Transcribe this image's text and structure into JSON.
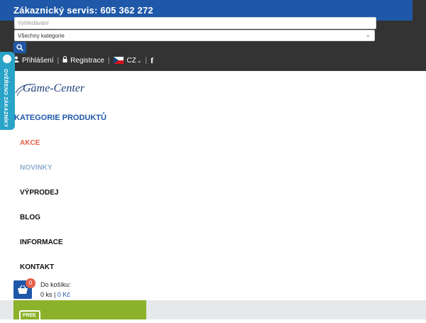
{
  "header": {
    "phone_text": "Zákaznický servis: 605 362 272",
    "search_placeholder": "Vyhledávání",
    "category_selected": "Všechny kategorie",
    "login_label": "Přihlášení",
    "register_label": "Registrace",
    "language": "CZ",
    "separator": "|"
  },
  "badge": {
    "text": "OVĚŘENO ZÁKAZNÍKY"
  },
  "logo": {
    "text": "Game-Center"
  },
  "nav": {
    "title": "KATEGORIE PRODUKTŮ",
    "items": [
      "AKCE",
      "NOVINKY",
      "VÝPRODEJ",
      "BLOG",
      "INFORMACE",
      "KONTAKT"
    ]
  },
  "cart": {
    "label": "Do košíku:",
    "count_badge": "0",
    "quantity": "0 ks",
    "separator": "|",
    "price": "0 Kč"
  },
  "promo": {
    "tag": "FREE"
  },
  "colors": {
    "brand_blue": "#1f58a8",
    "dark_bar": "#333333",
    "accent_red": "#e4604a",
    "badge_teal": "#2aa3c9",
    "promo_green": "#8bb22a"
  }
}
